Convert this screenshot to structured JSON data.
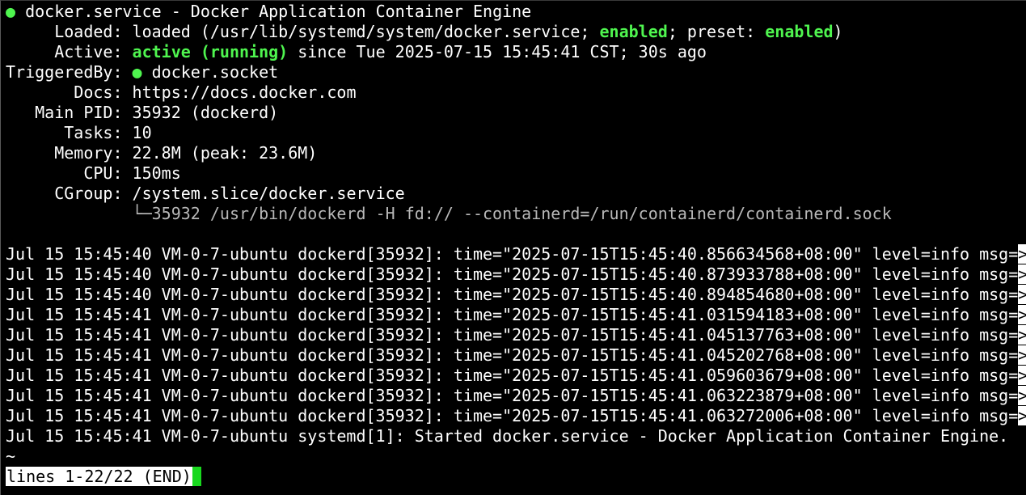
{
  "header": {
    "dot": "●",
    "title": "docker.service - Docker Application Container Engine"
  },
  "status": {
    "loaded_label": "     Loaded: ",
    "loaded_pre": "loaded (/usr/lib/systemd/system/docker.service; ",
    "loaded_enabled": "enabled",
    "loaded_mid": "; preset: ",
    "loaded_preset": "enabled",
    "loaded_post": ")",
    "active_label": "     Active: ",
    "active_state": "active (running)",
    "active_since": " since Tue 2025-07-15 15:45:41 CST; 30s ago",
    "triggered_label": "TriggeredBy: ",
    "triggered_dot": "●",
    "triggered_value": " docker.socket",
    "docs_label": "       Docs: ",
    "docs_value": "https://docs.docker.com",
    "pid_label": "   Main PID: ",
    "pid_value": "35932 (dockerd)",
    "tasks_label": "      Tasks: ",
    "tasks_value": "10",
    "memory_label": "     Memory: ",
    "memory_value": "22.8M (peak: 23.6M)",
    "cpu_label": "        CPU: ",
    "cpu_value": "150ms",
    "cgroup_label": "     CGroup: ",
    "cgroup_value": "/system.slice/docker.service",
    "cgroup_child_prefix": "             └─",
    "cgroup_child": "35932 /usr/bin/dockerd -H fd:// --containerd=/run/containerd/containerd.sock"
  },
  "log_lines": [
    "Jul 15 15:45:40 VM-0-7-ubuntu dockerd[35932]: time=\"2025-07-15T15:45:40.856634568+08:00\" level=info msg=",
    "Jul 15 15:45:40 VM-0-7-ubuntu dockerd[35932]: time=\"2025-07-15T15:45:40.873933788+08:00\" level=info msg=",
    "Jul 15 15:45:40 VM-0-7-ubuntu dockerd[35932]: time=\"2025-07-15T15:45:40.894854680+08:00\" level=info msg=",
    "Jul 15 15:45:41 VM-0-7-ubuntu dockerd[35932]: time=\"2025-07-15T15:45:41.031594183+08:00\" level=info msg=",
    "Jul 15 15:45:41 VM-0-7-ubuntu dockerd[35932]: time=\"2025-07-15T15:45:41.045137763+08:00\" level=info msg=",
    "Jul 15 15:45:41 VM-0-7-ubuntu dockerd[35932]: time=\"2025-07-15T15:45:41.045202768+08:00\" level=info msg=",
    "Jul 15 15:45:41 VM-0-7-ubuntu dockerd[35932]: time=\"2025-07-15T15:45:41.059603679+08:00\" level=info msg=",
    "Jul 15 15:45:41 VM-0-7-ubuntu dockerd[35932]: time=\"2025-07-15T15:45:41.063223879+08:00\" level=info msg=",
    "Jul 15 15:45:41 VM-0-7-ubuntu dockerd[35932]: time=\"2025-07-15T15:45:41.063272006+08:00\" level=info msg="
  ],
  "truncation_marker": ">",
  "final_log_line": "Jul 15 15:45:41 VM-0-7-ubuntu systemd[1]: Started docker.service - Docker Application Container Engine.",
  "tilde": "~",
  "pager_status": "lines 1-22/22 (END)",
  "colors": {
    "background": "#000000",
    "foreground": "#ffffff",
    "accent_green": "#4ff54f",
    "cursor": "#18d81e",
    "dim": "#b8b8b8"
  }
}
